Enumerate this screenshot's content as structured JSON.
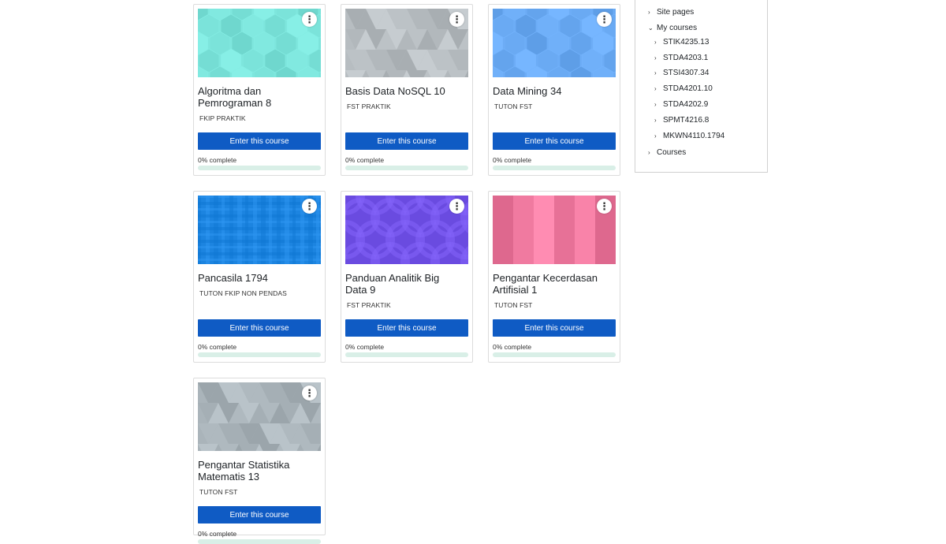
{
  "courses": [
    {
      "title": "Algoritma dan Pemrograman 8",
      "category": "FKIP PRAKTIK",
      "enter_label": "Enter this course",
      "progress_label": "0% complete",
      "progress": 0,
      "menu_icon": "more-vertical-icon",
      "thumb_color": "#7be3da"
    },
    {
      "title": "Basis Data NoSQL  10",
      "category": "FST PRAKTIK",
      "enter_label": "Enter this course",
      "progress_label": "0% complete",
      "progress": 0,
      "menu_icon": "more-vertical-icon",
      "thumb_color": "#b7bdc1"
    },
    {
      "title": "Data Mining 34",
      "category": "TUTON FST",
      "enter_label": "Enter this course",
      "progress_label": "0% complete",
      "progress": 0,
      "menu_icon": "more-vertical-icon",
      "thumb_color": "#6aaaf3"
    },
    {
      "title": "Pancasila 1794",
      "category": "TUTON FKIP NON PENDAS",
      "enter_label": "Enter this course",
      "progress_label": "0% complete",
      "progress": 0,
      "menu_icon": "more-vertical-icon",
      "thumb_color": "#1c84e0"
    },
    {
      "title": "Panduan Analitik Big Data 9",
      "category": "FST PRAKTIK",
      "enter_label": "Enter this course",
      "progress_label": "0% complete",
      "progress": 0,
      "menu_icon": "more-vertical-icon",
      "thumb_color": "#6a4be0"
    },
    {
      "title": "Pengantar Kecerdasan Artifisial  1",
      "category": "TUTON FST",
      "enter_label": "Enter this course",
      "progress_label": "0% complete",
      "progress": 0,
      "menu_icon": "more-vertical-icon",
      "thumb_color": "#f07aa0"
    },
    {
      "title": "Pengantar Statistika Matematis 13",
      "category": "TUTON FST",
      "enter_label": "Enter this course",
      "progress_label": "0% complete",
      "progress": 0,
      "menu_icon": "more-vertical-icon",
      "thumb_color": "#aab4ba"
    }
  ],
  "navigation": {
    "site_pages": "Site pages",
    "my_courses": "My courses",
    "course_codes": [
      "STIK4235.13",
      "STDA4203.1",
      "STSI4307.34",
      "STDA4201.10",
      "STDA4202.9",
      "SPMT4216.8",
      "MKWN4110.1794"
    ],
    "courses": "Courses",
    "collapsed_icon": "chevron-right-icon",
    "expanded_icon": "chevron-down-icon"
  },
  "colors": {
    "button": "#0f5bc4",
    "progress_track": "#d9efe7"
  }
}
